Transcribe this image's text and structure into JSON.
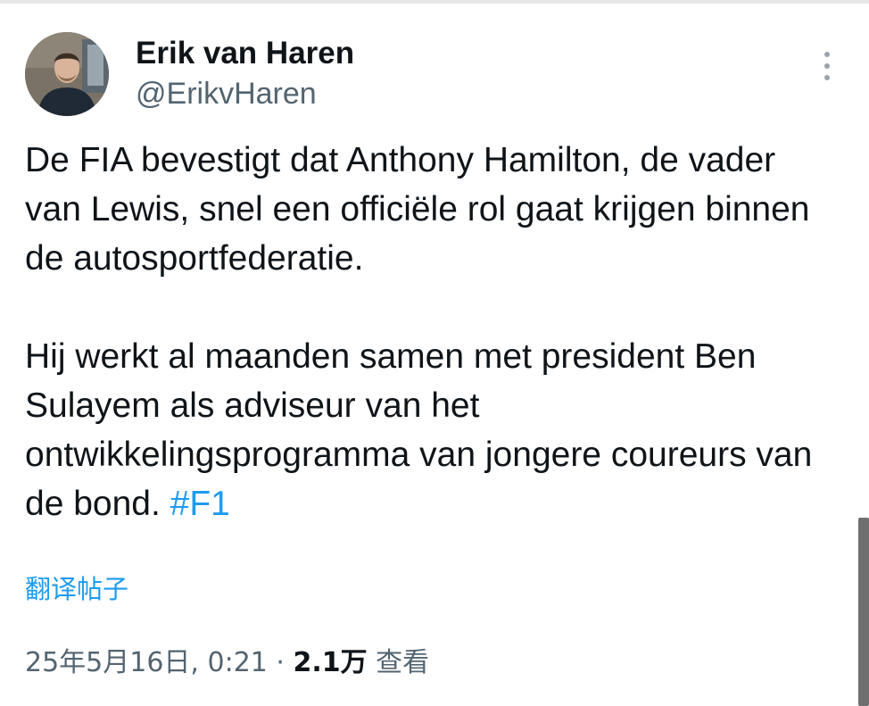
{
  "author": {
    "name": "Erik van Haren",
    "handle": "@ErikvHaren"
  },
  "more_icon": "more-vertical-icon",
  "tweet": {
    "paragraph_1": "De FIA bevestigt dat Anthony Hamilton, de vader van Lewis, snel een officiële rol gaat krijgen binnen de autosportfederatie.",
    "paragraph_2_text": "Hij werkt al maanden samen met president Ben Sulayem als adviseur van het ontwikkelingsprogramma van jongere coureurs van de bond. ",
    "hashtag": "#F1"
  },
  "translate_label": "翻译帖子",
  "meta": {
    "timestamp": "25年5月16日, 0:21",
    "separator": " · ",
    "views_count": "2.1万",
    "views_label": " 查看"
  },
  "colors": {
    "accent": "#1d9bf0",
    "secondary_text": "#536471",
    "primary_text": "#0f1419"
  }
}
